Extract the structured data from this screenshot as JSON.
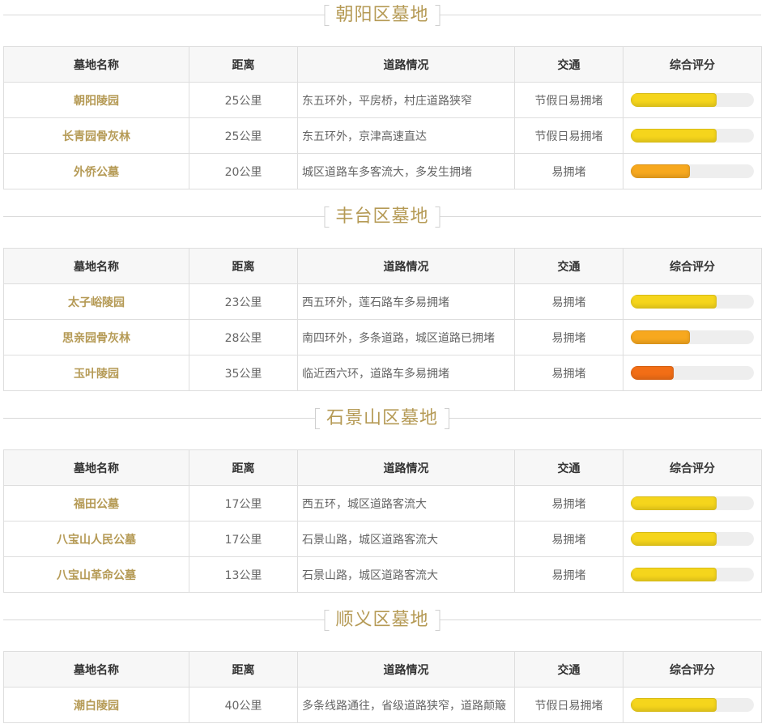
{
  "headers": {
    "name": "墓地名称",
    "distance": "距离",
    "road": "道路情况",
    "traffic": "交通",
    "score": "综合评分"
  },
  "colors": {
    "title": "#b59a55",
    "score_high": "#f5d51c",
    "score_mid": "#f7a81e",
    "score_low": "#f26e16"
  },
  "sections": [
    {
      "title": "朝阳区墓地",
      "rows": [
        {
          "name": "朝阳陵园",
          "distance": "25公里",
          "road": "东五环外，平房桥，村庄道路狭窄",
          "traffic": "节假日易拥堵",
          "score": 0.7,
          "level": "high"
        },
        {
          "name": "长青园骨灰林",
          "distance": "25公里",
          "road": "东五环外，京津高速直达",
          "traffic": "节假日易拥堵",
          "score": 0.7,
          "level": "high"
        },
        {
          "name": "外侨公墓",
          "distance": "20公里",
          "road": "城区道路车多客流大，多发生拥堵",
          "traffic": "易拥堵",
          "score": 0.48,
          "level": "mid"
        }
      ]
    },
    {
      "title": "丰台区墓地",
      "rows": [
        {
          "name": "太子峪陵园",
          "distance": "23公里",
          "road": "西五环外，莲石路车多易拥堵",
          "traffic": "易拥堵",
          "score": 0.7,
          "level": "high"
        },
        {
          "name": "思亲园骨灰林",
          "distance": "28公里",
          "road": "南四环外，多条道路，城区道路已拥堵",
          "traffic": "易拥堵",
          "score": 0.48,
          "level": "mid"
        },
        {
          "name": "玉叶陵园",
          "distance": "35公里",
          "road": "临近西六环，道路车多易拥堵",
          "traffic": "易拥堵",
          "score": 0.35,
          "level": "low"
        }
      ]
    },
    {
      "title": "石景山区墓地",
      "rows": [
        {
          "name": "福田公墓",
          "distance": "17公里",
          "road": "西五环，城区道路客流大",
          "traffic": "易拥堵",
          "score": 0.7,
          "level": "high"
        },
        {
          "name": "八宝山人民公墓",
          "distance": "17公里",
          "road": "石景山路，城区道路客流大",
          "traffic": "易拥堵",
          "score": 0.7,
          "level": "high"
        },
        {
          "name": "八宝山革命公墓",
          "distance": "13公里",
          "road": "石景山路，城区道路客流大",
          "traffic": "易拥堵",
          "score": 0.7,
          "level": "high"
        }
      ]
    },
    {
      "title": "顺义区墓地",
      "rows": [
        {
          "name": "潮白陵园",
          "distance": "40公里",
          "road": "多条线路通往，省级道路狭窄，道路颠簸",
          "traffic": "节假日易拥堵",
          "score": 0.7,
          "level": "high"
        }
      ]
    }
  ]
}
